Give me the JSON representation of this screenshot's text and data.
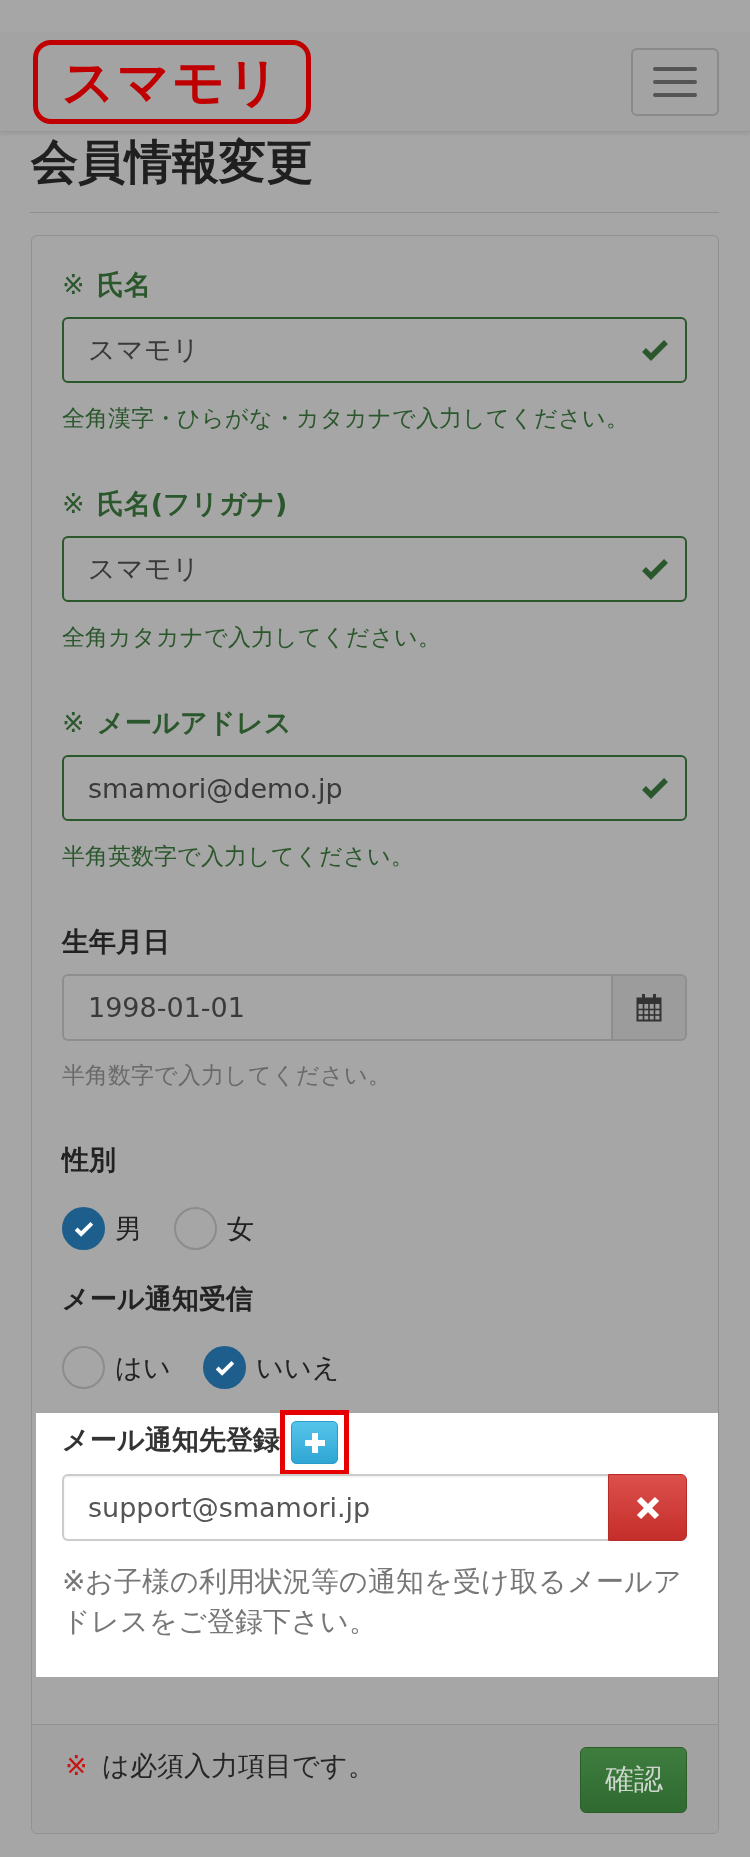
{
  "overlay": true,
  "header": {
    "logo": "スマモリ"
  },
  "title": "会員情報変更",
  "form": {
    "fields": [
      {
        "kind": "text",
        "spotlight": false,
        "mark": "※",
        "label": "氏名",
        "value": "スマモリ",
        "valid": true,
        "help": "全角漢字・ひらがな・カタカナで入力してください。"
      },
      {
        "kind": "text",
        "spotlight": false,
        "mark": "※",
        "label": "氏名(フリガナ)",
        "value": "スマモリ",
        "valid": true,
        "help": "全角カタカナで入力してください。"
      },
      {
        "kind": "text",
        "spotlight": false,
        "mark": "※",
        "label": "メールアドレス",
        "value": "smamori@demo.jp",
        "valid": true,
        "help": "半角英数字で入力してください。"
      },
      {
        "kind": "date",
        "spotlight": false,
        "label": "生年月日",
        "value": "1998-01-01",
        "help": "半角数字で入力してください。"
      },
      {
        "kind": "radio",
        "spotlight": false,
        "label": "性別",
        "options": [
          {
            "label": "男",
            "selected": true
          },
          {
            "label": "女",
            "selected": false
          }
        ]
      },
      {
        "kind": "radio",
        "spotlight": false,
        "label": "メール通知受信",
        "options": [
          {
            "label": "はい",
            "selected": false
          },
          {
            "label": "いいえ",
            "selected": true
          }
        ]
      },
      {
        "kind": "email_list",
        "spotlight": true,
        "label": "メール通知先登録",
        "entries": [
          {
            "value": "support@smamori.jp"
          }
        ],
        "note": "※お子様の利用状況等の通知を受け取るメールアドレスをご登録下さい。"
      }
    ],
    "footer": {
      "mark": "※",
      "note": "は必須入力項目です。",
      "submit": "確認"
    }
  }
}
